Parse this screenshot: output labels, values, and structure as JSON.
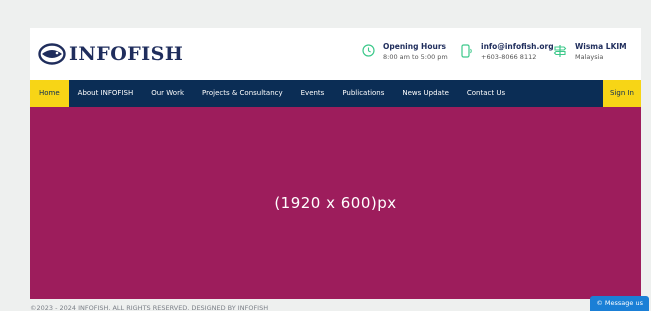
{
  "logo": {
    "text": "INFOFISH",
    "icon": "fish-logo-icon"
  },
  "header": {
    "hours": {
      "title": "Opening Hours",
      "sub": "8:00 am to 5:00 pm",
      "icon": "clock-icon"
    },
    "contact": {
      "title": "info@infofish.org",
      "sub": "+603-8066 8112",
      "icon": "phone-icon"
    },
    "location": {
      "title": "Wisma LKIM",
      "sub": "Malaysia",
      "icon": "signpost-icon"
    }
  },
  "nav": {
    "items": [
      {
        "label": "Home"
      },
      {
        "label": "About INFOFISH"
      },
      {
        "label": "Our Work"
      },
      {
        "label": "Projects & Consultancy"
      },
      {
        "label": "Events"
      },
      {
        "label": "Publications"
      },
      {
        "label": "News Update"
      },
      {
        "label": "Contact Us"
      }
    ],
    "signin": "Sign In"
  },
  "hero": {
    "text": "(1920 x 600)px"
  },
  "footer": {
    "text": "©2023 - 2024 INFOFISH. ALL RIGHTS RESERVED. DESIGNED BY INFOFISH"
  },
  "chat": {
    "label": "© Message us"
  },
  "colors": {
    "nav_bg": "#0b2d55",
    "accent": "#f7d516",
    "hero_bg": "#9d1d5c",
    "icon_green": "#3cc88a",
    "logo_navy": "#1f2d5c"
  }
}
